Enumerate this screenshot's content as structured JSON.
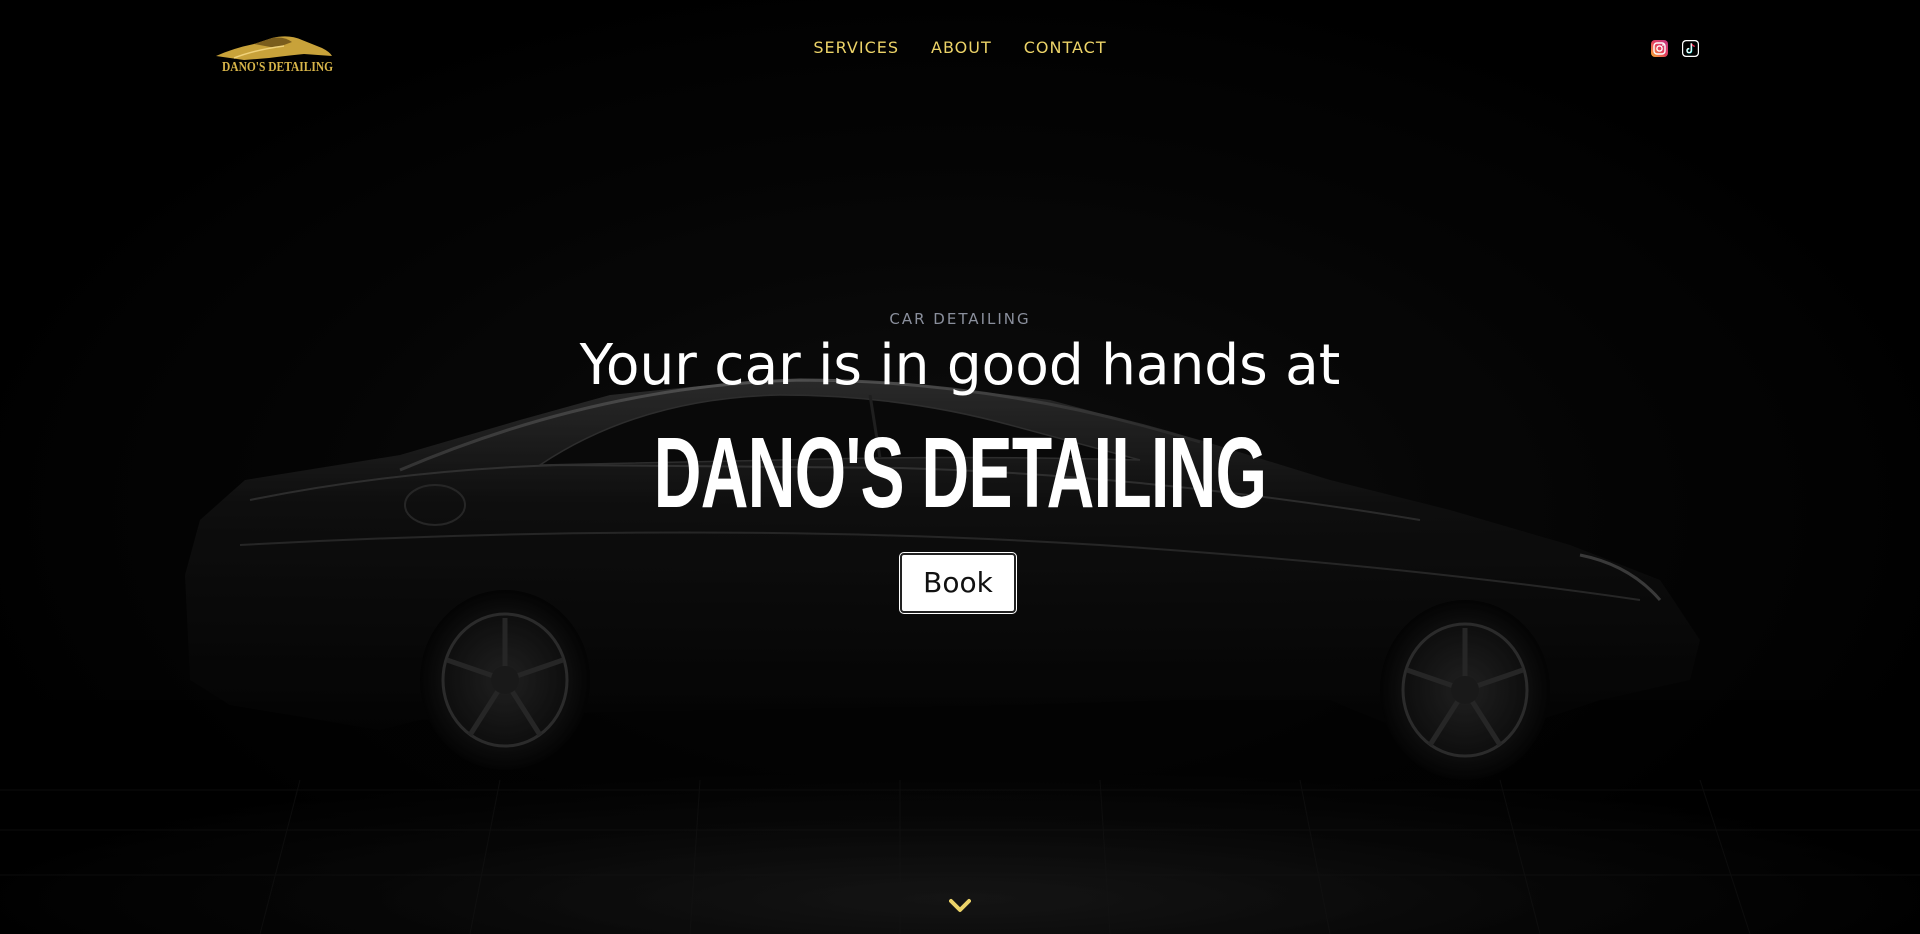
{
  "colors": {
    "accent": "#ecd368",
    "logo_gold": "#d9b64a",
    "eyebrow": "#8a8f9c",
    "headline": "#ffffff",
    "background": "#000000"
  },
  "header": {
    "logo_text": "DANO'S DETAILING",
    "nav": [
      {
        "label": "SERVICES"
      },
      {
        "label": "ABOUT"
      },
      {
        "label": "CONTACT"
      }
    ],
    "social": [
      {
        "icon": "instagram-icon"
      },
      {
        "icon": "tiktok-icon"
      }
    ]
  },
  "hero": {
    "eyebrow": "CAR DETAILING",
    "headline": "Your car is in good hands at",
    "brand": "DANO'S DETAILING",
    "cta_label": "Book",
    "scroll_icon": "chevron-down-icon"
  }
}
